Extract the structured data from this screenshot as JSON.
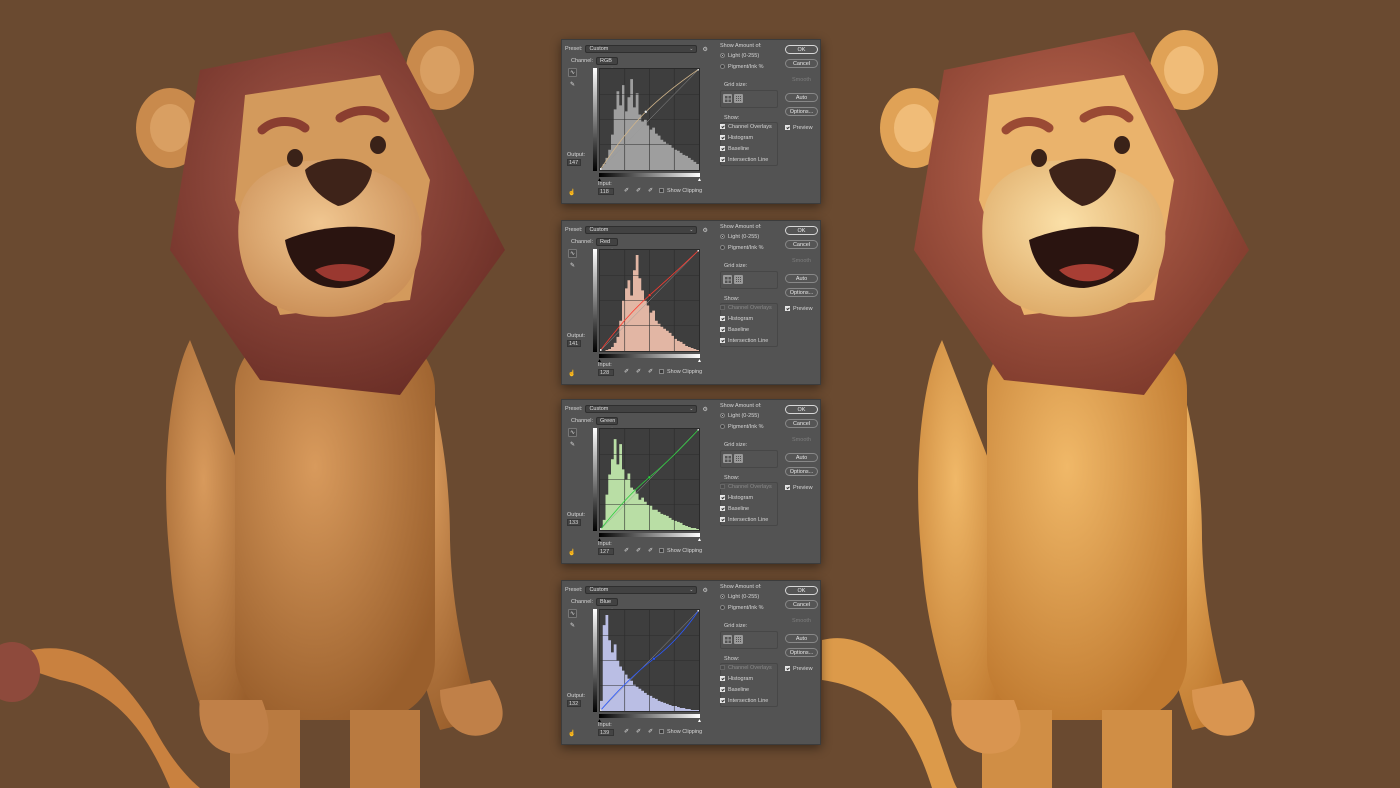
{
  "panels": [
    {
      "id": "rgb",
      "preset_label": "Preset:",
      "preset_value": "Custom",
      "channel_label": "Channel:",
      "channel_value": "RGB",
      "output_label": "Output:",
      "output_value": "147",
      "input_label": "Input:",
      "input_value": "118",
      "show_clipping": "Show Clipping",
      "histogram_color": "#a8a8a8",
      "curve_color": "#d0b48a",
      "point_color": "#e8e8e8",
      "histogram": [
        0.02,
        0.06,
        0.12,
        0.2,
        0.35,
        0.6,
        0.78,
        0.64,
        0.84,
        0.58,
        0.72,
        0.9,
        0.62,
        0.76,
        0.55,
        0.48,
        0.5,
        0.44,
        0.4,
        0.42,
        0.36,
        0.34,
        0.3,
        0.28,
        0.26,
        0.25,
        0.22,
        0.2,
        0.19,
        0.17,
        0.15,
        0.14,
        0.12,
        0.1,
        0.08,
        0.06
      ]
    },
    {
      "id": "red",
      "preset_label": "Preset:",
      "preset_value": "Custom",
      "channel_label": "Channel:",
      "channel_value": "Red",
      "output_label": "Output:",
      "output_value": "141",
      "input_label": "Input:",
      "input_value": "128",
      "show_clipping": "Show Clipping",
      "histogram_color": "#f4c3af",
      "curve_color": "#ff3b30",
      "point_color": "#ff3b30",
      "histogram": [
        0.0,
        0.0,
        0.01,
        0.02,
        0.04,
        0.08,
        0.14,
        0.3,
        0.5,
        0.62,
        0.7,
        0.55,
        0.8,
        0.95,
        0.72,
        0.6,
        0.5,
        0.45,
        0.38,
        0.4,
        0.3,
        0.27,
        0.24,
        0.22,
        0.2,
        0.18,
        0.15,
        0.12,
        0.1,
        0.09,
        0.07,
        0.05,
        0.04,
        0.03,
        0.02,
        0.01
      ]
    },
    {
      "id": "green",
      "preset_label": "Preset:",
      "preset_value": "Custom",
      "channel_label": "Channel:",
      "channel_value": "Green",
      "output_label": "Output:",
      "output_value": "133",
      "input_label": "Input:",
      "input_value": "127",
      "show_clipping": "Show Clipping",
      "histogram_color": "#c6f0b0",
      "curve_color": "#2ecc40",
      "point_color": "#2ecc40",
      "histogram": [
        0.02,
        0.1,
        0.35,
        0.55,
        0.7,
        0.9,
        0.65,
        0.85,
        0.6,
        0.5,
        0.56,
        0.42,
        0.4,
        0.36,
        0.3,
        0.32,
        0.28,
        0.25,
        0.24,
        0.2,
        0.2,
        0.18,
        0.16,
        0.15,
        0.14,
        0.12,
        0.1,
        0.09,
        0.08,
        0.07,
        0.05,
        0.04,
        0.03,
        0.02,
        0.02,
        0.01
      ]
    },
    {
      "id": "blue",
      "preset_label": "Preset:",
      "preset_value": "Custom",
      "channel_label": "Channel:",
      "channel_value": "Blue",
      "output_label": "Output:",
      "output_value": "132",
      "input_label": "Input:",
      "input_value": "139",
      "show_clipping": "Show Clipping",
      "histogram_color": "#c8ccf6",
      "curve_color": "#2a58ff",
      "point_color": "#2a58ff",
      "histogram": [
        0.1,
        0.85,
        0.95,
        0.7,
        0.58,
        0.66,
        0.5,
        0.44,
        0.4,
        0.36,
        0.32,
        0.3,
        0.26,
        0.24,
        0.22,
        0.2,
        0.18,
        0.16,
        0.15,
        0.13,
        0.12,
        0.1,
        0.09,
        0.08,
        0.07,
        0.06,
        0.05,
        0.05,
        0.04,
        0.03,
        0.03,
        0.02,
        0.02,
        0.01,
        0.01,
        0.01
      ]
    }
  ],
  "options": {
    "show_amount_label": "Show Amount of:",
    "light_label": "Light  (0-255)",
    "pigment_label": "Pigment/Ink %",
    "grid_size_label": "Grid size:",
    "show_label": "Show:",
    "channel_overlays": "Channel Overlays",
    "histogram": "Histogram",
    "baseline": "Baseline",
    "intersection_line": "Intersection Line"
  },
  "buttons": {
    "ok": "OK",
    "cancel": "Cancel",
    "smooth": "Smooth",
    "auto": "Auto",
    "options": "Options...",
    "preview": "Preview"
  }
}
